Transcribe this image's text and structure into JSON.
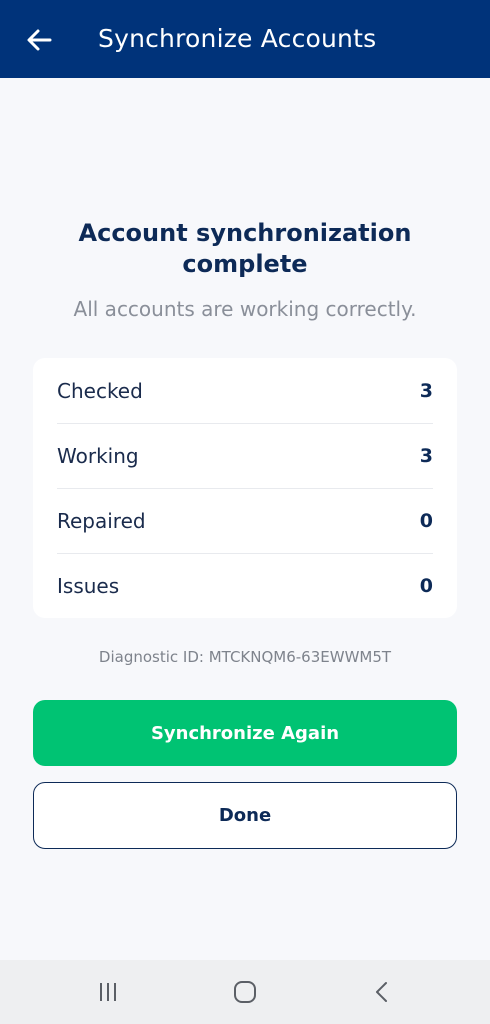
{
  "header": {
    "title": "Synchronize Accounts",
    "back_icon": "arrow-left-icon",
    "background_color": "#00337a"
  },
  "result": {
    "heading_line1": "Account synchronization",
    "heading_line2": "complete",
    "subtitle": "All accounts are working correctly."
  },
  "summary": {
    "rows": [
      {
        "label": "Checked",
        "value": "3"
      },
      {
        "label": "Working",
        "value": "3"
      },
      {
        "label": "Repaired",
        "value": "0"
      },
      {
        "label": "Issues",
        "value": "0"
      }
    ]
  },
  "diagnostic": {
    "text": "Diagnostic ID: MTCKNQM6-63EWWM5T"
  },
  "actions": {
    "primary_label": "Synchronize Again",
    "primary_color": "#00c373",
    "secondary_label": "Done"
  },
  "system_nav": {
    "recents_icon": "recent-apps-icon",
    "home_icon": "home-icon",
    "back_icon": "back-chevron-icon"
  }
}
